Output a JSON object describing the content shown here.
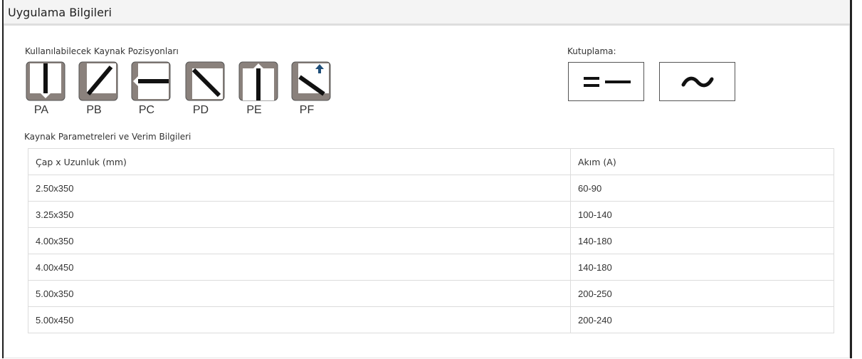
{
  "panel": {
    "title": "Uygulama Bilgileri"
  },
  "positions": {
    "heading": "Kullanılabilecek Kaynak Pozisyonları",
    "items": [
      {
        "label": "PA",
        "icon": "weld-position-pa-icon"
      },
      {
        "label": "PB",
        "icon": "weld-position-pb-icon"
      },
      {
        "label": "PC",
        "icon": "weld-position-pc-icon"
      },
      {
        "label": "PD",
        "icon": "weld-position-pd-icon"
      },
      {
        "label": "PE",
        "icon": "weld-position-pe-icon"
      },
      {
        "label": "PF",
        "icon": "weld-position-pf-icon"
      }
    ]
  },
  "polarity": {
    "heading": "Kutuplama:",
    "items": [
      {
        "name": "direct-current",
        "icon": "dc-polarity-icon"
      },
      {
        "name": "alternating-current",
        "icon": "ac-polarity-icon"
      }
    ]
  },
  "params": {
    "heading": "Kaynak Parametreleri ve Verim Bilgileri",
    "columns": [
      "Çap x Uzunluk (mm)",
      "Akım (A)"
    ],
    "rows": [
      [
        "2.50x350",
        "60-90"
      ],
      [
        "3.25x350",
        "100-140"
      ],
      [
        "4.00x350",
        "140-180"
      ],
      [
        "4.00x450",
        "140-180"
      ],
      [
        "5.00x350",
        "200-250"
      ],
      [
        "5.00x450",
        "200-240"
      ]
    ]
  },
  "colors": {
    "icon_fill": "#8a817c",
    "icon_bar": "#111111",
    "arrow_blue": "#1f4e79"
  }
}
